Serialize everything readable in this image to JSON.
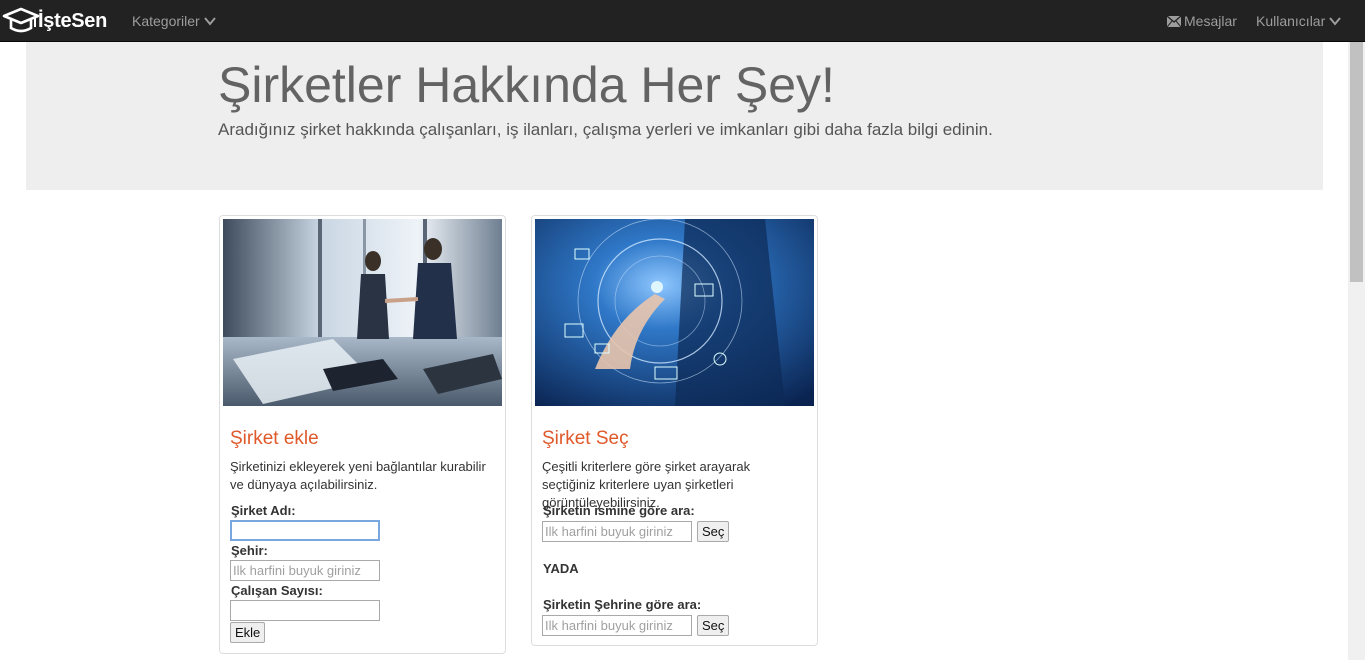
{
  "navbar": {
    "brand": "İşteSen",
    "categories_label": "Kategoriler",
    "messages_label": "Mesajlar",
    "users_label": "Kullanıcılar"
  },
  "jumbotron": {
    "title": "Şirketler Hakkında Her Şey!",
    "subtitle": "Aradığınız şirket hakkında çalışanları, iş ilanları, çalışma yerleri ve imkanları gibi daha fazla bilgi edinin."
  },
  "add_card": {
    "title": "Şirket ekle",
    "description": "Şirketinizi ekleyerek yeni bağlantılar kurabilir ve dünyaya açılabilirsiniz.",
    "company_name_label": "Şirket Adı:",
    "company_name_value": "",
    "city_label": "Şehir:",
    "city_placeholder": "Ilk harfini buyuk giriniz",
    "employee_count_label": "Çalışan Sayısı:",
    "employee_count_value": "",
    "add_button": "Ekle"
  },
  "select_card": {
    "title": "Şirket Seç",
    "description": "Çeşitli kriterlere göre şirket arayarak seçtiğiniz kriterlere uyan şirketleri görüntüleyebilirsiniz.",
    "by_name_label": "Şirketin ismine göre ara:",
    "by_name_placeholder": "Ilk harfini buyuk giriniz",
    "by_name_button": "Seç",
    "or_label": "YADA",
    "by_city_label": "Şirketin Şehrine göre ara:",
    "by_city_placeholder": "Ilk harfini buyuk giriniz",
    "by_city_button": "Seç"
  },
  "icons": {
    "brand": "graduation-cap-icon",
    "categories": "chevron-down-icon",
    "messages": "envelope-icon",
    "users": "chevron-down-icon"
  },
  "colors": {
    "navbar_bg": "#222222",
    "jumbotron_bg": "#eeeeee",
    "card_title": "#e0592a"
  }
}
